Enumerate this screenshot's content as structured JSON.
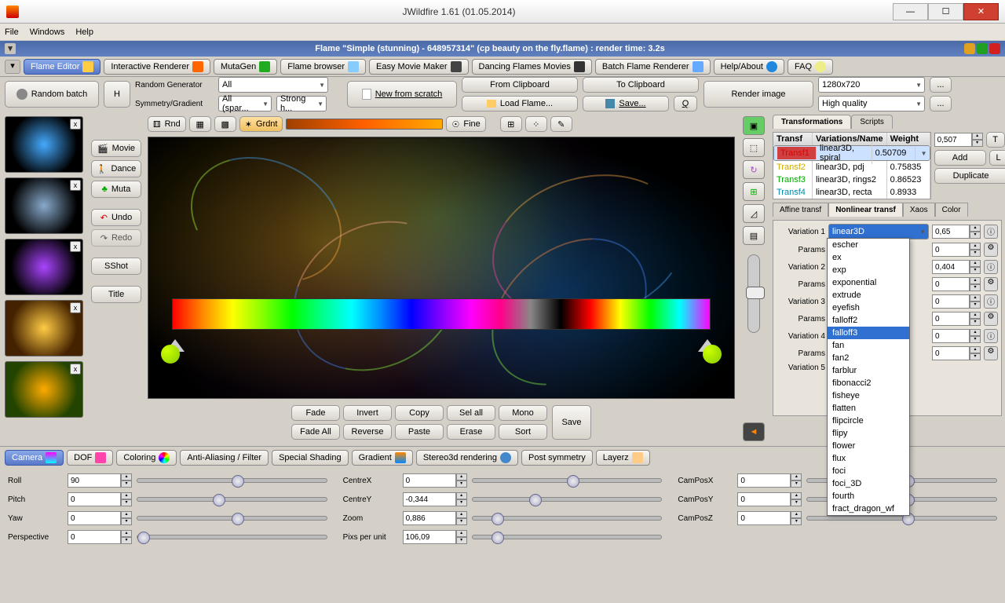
{
  "window": {
    "title": "JWildfire 1.61 (01.05.2014)"
  },
  "menu": {
    "file": "File",
    "windows": "Windows",
    "help": "Help"
  },
  "internal_title": "Flame \"Simple (stunning) - 648957314\" (cp beauty on the fly.flame) : render time: 3.2s",
  "tabs": {
    "flame_editor": "Flame Editor",
    "interactive": "Interactive Renderer",
    "mutagen": "MutaGen",
    "browser": "Flame browser",
    "moviemaker": "Easy Movie Maker",
    "dancing": "Dancing Flames Movies",
    "batch": "Batch Flame Renderer",
    "help": "Help/About",
    "faq": "FAQ"
  },
  "top": {
    "random_batch": "Random batch",
    "h": "H",
    "random_gen_label": "Random Generator",
    "random_gen_value": "All",
    "symmetry_label": "Symmetry/Gradient",
    "symmetry_value": "All (spar...",
    "strong_hue": "Strong h...",
    "new_scratch": "New from scratch",
    "from_clip": "From Clipboard",
    "to_clip": "To Clipboard",
    "load": "Load Flame...",
    "save": "Save...",
    "q": "Q",
    "render": "Render image",
    "res": "1280x720",
    "quality": "High quality",
    "dots": "..."
  },
  "side": {
    "rnd": "Rnd",
    "grdnt": "Grdnt",
    "fine": "Fine",
    "movie": "Movie",
    "dance": "Dance",
    "muta": "Muta",
    "undo": "Undo",
    "redo": "Redo",
    "sshot": "SShot",
    "title": "Title"
  },
  "gradient_ops": {
    "fade": "Fade",
    "invert": "Invert",
    "copy": "Copy",
    "selall": "Sel all",
    "mono": "Mono",
    "fadeall": "Fade All",
    "reverse": "Reverse",
    "paste": "Paste",
    "erase": "Erase",
    "sort": "Sort",
    "save": "Save"
  },
  "right": {
    "transformations": "Transformations",
    "scripts": "Scripts",
    "transf": "Transf",
    "varname": "Variations/Name",
    "weight": "Weight",
    "rows": [
      {
        "t": "Transf1",
        "v": "linear3D, spiral",
        "w": "0.50709"
      },
      {
        "t": "Transf2",
        "v": "linear3D, pdj",
        "w": "0.75835"
      },
      {
        "t": "Transf3",
        "v": "linear3D, rings2",
        "w": "0.86523"
      },
      {
        "t": "Transf4",
        "v": "linear3D, recta",
        "w": "0.8933"
      }
    ],
    "wval": "0,507",
    "t": "T",
    "add": "Add",
    "l": "L",
    "dup": "Duplicate",
    "affine": "Affine transf",
    "nonlinear": "Nonlinear transf",
    "xaos": "Xaos",
    "color": "Color",
    "var1": "Variation 1",
    "var2": "Variation 2",
    "var3": "Variation 3",
    "var4": "Variation 4",
    "var5": "Variation 5",
    "params": "Params",
    "var1_sel": "linear3D",
    "var1_val": "0,65",
    "var2_val": "0,404",
    "zero": "0",
    "options": [
      "escher",
      "ex",
      "exp",
      "exponential",
      "extrude",
      "eyefish",
      "falloff2",
      "falloff3",
      "fan",
      "fan2",
      "farblur",
      "fibonacci2",
      "fisheye",
      "flatten",
      "flipcircle",
      "flipy",
      "flower",
      "flux",
      "foci",
      "foci_3D",
      "fourth",
      "fract_dragon_wf"
    ]
  },
  "btabs": {
    "camera": "Camera",
    "dof": "DOF",
    "coloring": "Coloring",
    "aa": "Anti-Aliasing / Filter",
    "shading": "Special Shading",
    "gradient": "Gradient",
    "stereo": "Stereo3d rendering",
    "postsym": "Post symmetry",
    "layerz": "Layerz"
  },
  "sliders": {
    "roll": "Roll",
    "roll_v": "90",
    "pitch": "Pitch",
    "pitch_v": "0",
    "yaw": "Yaw",
    "yaw_v": "0",
    "persp": "Perspective",
    "persp_v": "0",
    "cx": "CentreX",
    "cx_v": "0",
    "cy": "CentreY",
    "cy_v": "-0,344",
    "zoom": "Zoom",
    "zoom_v": "0,886",
    "ppu": "Pixs per unit",
    "ppu_v": "106,09",
    "cpx": "CamPosX",
    "cpx_v": "0",
    "cpy": "CamPosY",
    "cpy_v": "0",
    "cpz": "CamPosZ",
    "cpz_v": "0"
  }
}
